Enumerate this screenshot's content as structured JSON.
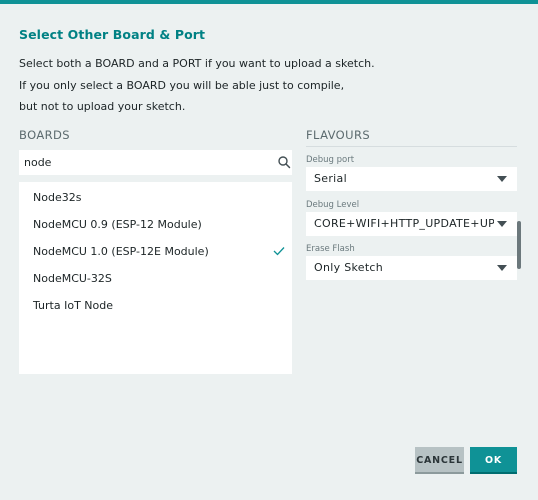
{
  "dialog": {
    "title": "Select Other Board & Port",
    "intro": [
      "Select both a BOARD and a PORT if you want to upload a sketch.",
      "If you only select a BOARD you will be able just to compile,",
      "but not to upload your sketch."
    ]
  },
  "boards": {
    "title": "BOARDS",
    "search": {
      "value": "node",
      "placeholder": ""
    },
    "items": [
      {
        "label": "Node32s",
        "selected": false
      },
      {
        "label": "NodeMCU 0.9 (ESP-12 Module)",
        "selected": false
      },
      {
        "label": "NodeMCU 1.0 (ESP-12E Module)",
        "selected": true
      },
      {
        "label": "NodeMCU-32S",
        "selected": false
      },
      {
        "label": "Turta IoT Node",
        "selected": false
      }
    ]
  },
  "flavours": {
    "title": "FLAVOURS",
    "options": [
      {
        "label": "Debug port",
        "value": "Serial"
      },
      {
        "label": "Debug Level",
        "value": "CORE+WIFI+HTTP_UPDATE+UPDATER"
      },
      {
        "label": "Erase Flash",
        "value": "Only Sketch"
      }
    ]
  },
  "buttons": {
    "cancel": "CANCEL",
    "ok": "OK"
  },
  "colors": {
    "accent": "#0f9296",
    "background": "#ecf1f1",
    "title": "#008184"
  },
  "icons": {
    "search": "search-icon",
    "check": "check-icon",
    "dropdown": "chevron-down-icon"
  }
}
